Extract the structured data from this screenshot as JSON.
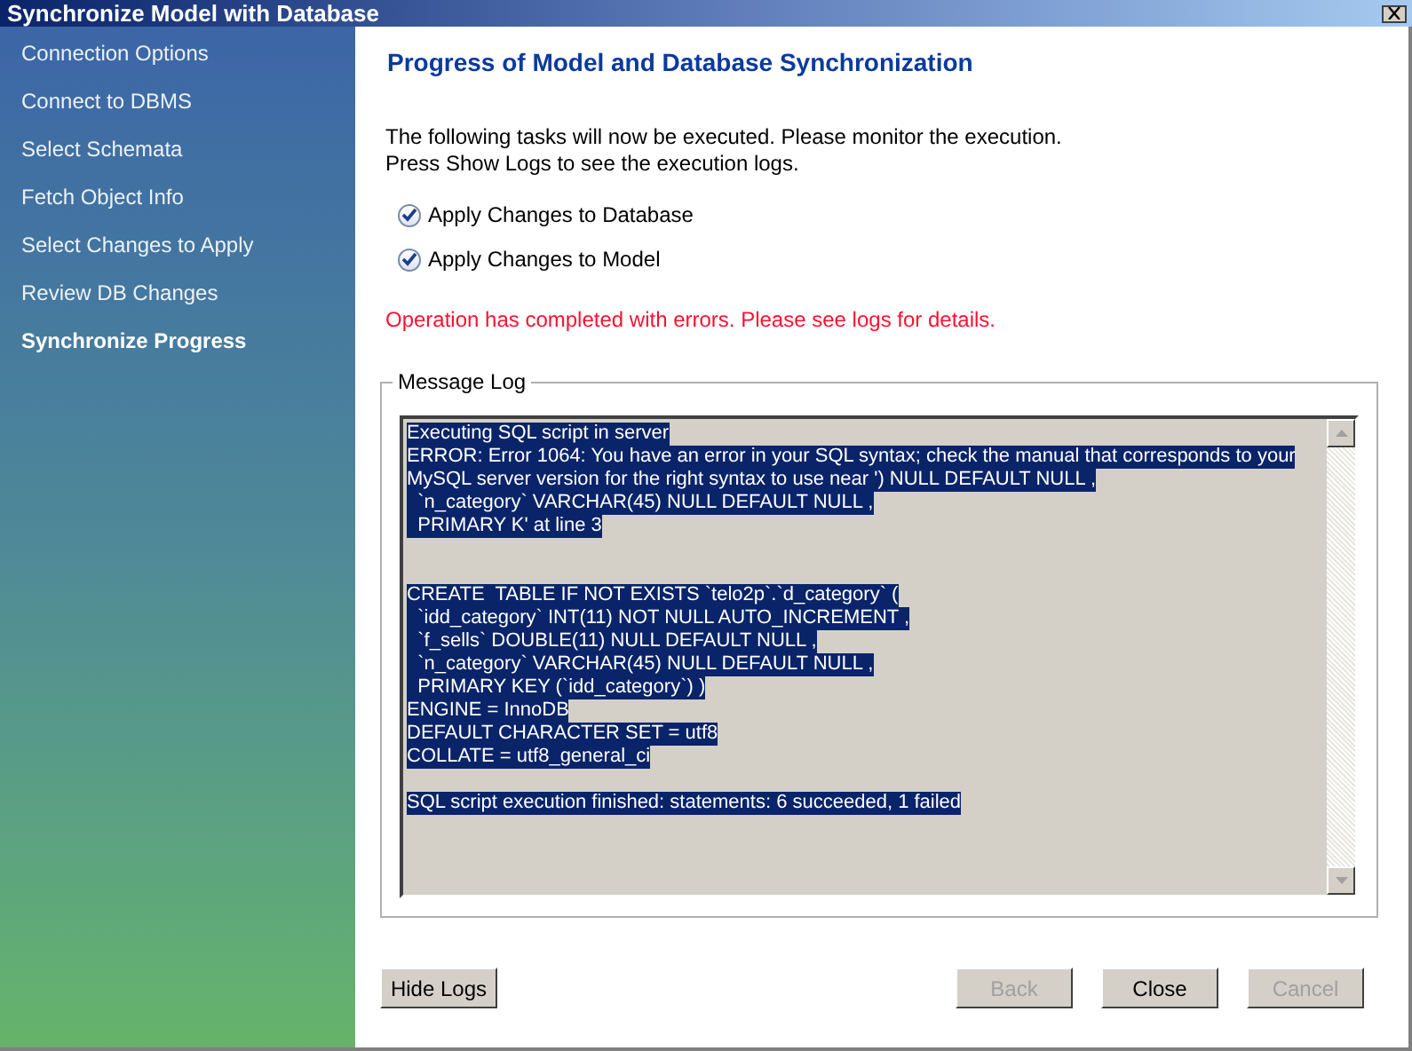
{
  "window": {
    "title": "Synchronize Model with Database"
  },
  "sidebar": {
    "items": [
      {
        "label": "Connection Options",
        "selected": false
      },
      {
        "label": "Connect to DBMS",
        "selected": false
      },
      {
        "label": "Select Schemata",
        "selected": false
      },
      {
        "label": "Fetch Object Info",
        "selected": false
      },
      {
        "label": "Select Changes to Apply",
        "selected": false
      },
      {
        "label": "Review DB Changes",
        "selected": false
      },
      {
        "label": "Synchronize Progress",
        "selected": true
      }
    ]
  },
  "heading": "Progress of Model and Database Synchronization",
  "intro": [
    "The following tasks will now be executed. Please monitor the execution.",
    "Press Show Logs to see the execution logs."
  ],
  "tasks": [
    {
      "label": "Apply Changes to Database",
      "checked": true
    },
    {
      "label": "Apply Changes to Model",
      "checked": true
    }
  ],
  "status_message": "Operation has completed with errors. Please see logs for details.",
  "message_log": {
    "title": "Message Log",
    "blocks": [
      [
        "Executing SQL script in server",
        "ERROR: Error 1064: You have an error in your SQL syntax; check the manual that corresponds to your",
        "MySQL server version for the right syntax to use near ') NULL DEFAULT NULL ,",
        "  `n_category` VARCHAR(45) NULL DEFAULT NULL ,",
        "  PRIMARY K' at line 3"
      ],
      [
        "CREATE  TABLE IF NOT EXISTS `telo2p`.`d_category` (",
        "  `idd_category` INT(11) NOT NULL AUTO_INCREMENT ,",
        "  `f_sells` DOUBLE(11) NULL DEFAULT NULL ,",
        "  `n_category` VARCHAR(45) NULL DEFAULT NULL ,",
        "  PRIMARY KEY (`idd_category`) )",
        "ENGINE = InnoDB",
        "DEFAULT CHARACTER SET = utf8",
        "COLLATE = utf8_general_ci"
      ],
      [
        "SQL script execution finished: statements: 6 succeeded, 1 failed"
      ]
    ]
  },
  "buttons": {
    "left": [
      {
        "label": "Hide Logs",
        "disabled": false
      }
    ],
    "right": [
      {
        "label": "Back",
        "disabled": true
      },
      {
        "label": "Close",
        "disabled": false
      },
      {
        "label": "Cancel",
        "disabled": true
      }
    ]
  }
}
